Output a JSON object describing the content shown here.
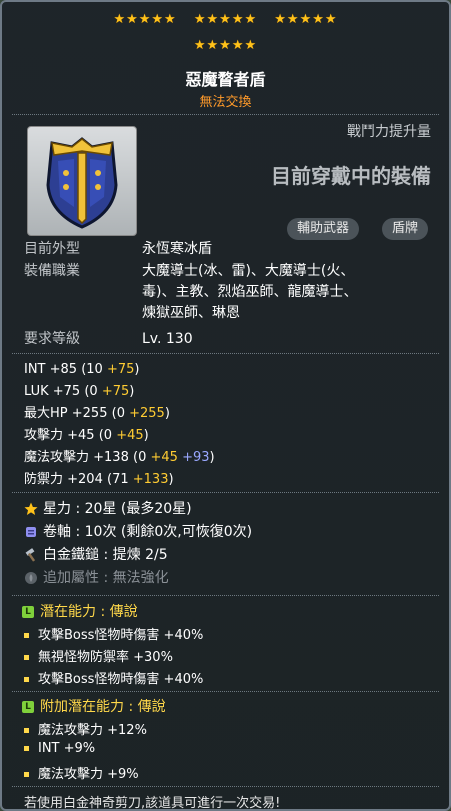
{
  "stars": {
    "row1": [
      "★★★★★",
      "★★★★★",
      "★★★★★"
    ],
    "row2": [
      "★★★★★"
    ]
  },
  "item": {
    "name": "惡魔瞀者盾",
    "tradeability": "無法交換"
  },
  "header": {
    "combat_power_label": "戰鬥力提升量",
    "equipped_text": "目前穿戴中的裝備",
    "badges": [
      "輔助武器",
      "盾牌"
    ]
  },
  "info": {
    "appearance_label": "目前外型",
    "appearance_value": "永恆寒冰盾",
    "jobs_label": "裝備職業",
    "jobs_lines": [
      "大魔導士(冰、雷)、大魔導士(火、",
      "毒)、主教、烈焰巫師、龍魔導士、",
      "煉獄巫師、琳恩"
    ],
    "level_label": "要求等級",
    "level_value": "Lv. 130"
  },
  "stats": [
    {
      "name": "INT",
      "total": "+85",
      "base": "10",
      "bonuses": [
        {
          "v": "+75",
          "c": "yel"
        }
      ]
    },
    {
      "name": "LUK",
      "total": "+75",
      "base": "0",
      "bonuses": [
        {
          "v": "+75",
          "c": "yel"
        }
      ]
    },
    {
      "name": "最大HP",
      "total": "+255",
      "base": "0",
      "bonuses": [
        {
          "v": "+255",
          "c": "yel"
        }
      ]
    },
    {
      "name": "攻擊力",
      "total": "+45",
      "base": "0",
      "bonuses": [
        {
          "v": "+45",
          "c": "yel"
        }
      ]
    },
    {
      "name": "魔法攻擊力",
      "total": "+138",
      "base": "0",
      "bonuses": [
        {
          "v": "+45",
          "c": "yel"
        },
        {
          "v": "+93",
          "c": "blu"
        }
      ]
    },
    {
      "name": "防禦力",
      "total": "+204",
      "base": "71",
      "bonuses": [
        {
          "v": "+133",
          "c": "yel"
        }
      ]
    }
  ],
  "enhance": {
    "starforce_label": "星力",
    "starforce_value": "20星 (最多20星)",
    "scroll_label": "卷軸",
    "scroll_value": "10次 (剩餘0次,可恢復0次)",
    "hammer_label": "白金鐵鎚",
    "hammer_value": "提煉 2/5",
    "additional_label": "追加屬性",
    "additional_value": "無法強化"
  },
  "potential": {
    "head": "潛在能力 : 傳說",
    "lines": [
      "攻擊Boss怪物時傷害 +40%",
      "無視怪物防禦率 +30%",
      "攻擊Boss怪物時傷害 +40%"
    ]
  },
  "bonus_potential": {
    "head": "附加潛在能力 : 傳說",
    "lines": [
      "魔法攻擊力 +12%",
      "INT +9%",
      "魔法攻擊力 +9%"
    ]
  },
  "footer": "若使用白金神奇剪刀,該道具可進行一次交易!",
  "colors": {
    "star": "#ffc21a",
    "orange": "#ff9a2a",
    "bonus_yellow": "#ffcc33",
    "bonus_blue": "#9aa8ff",
    "potential_icon": "#7fd03b"
  },
  "icons": {
    "item": "shield-icon",
    "star": "star-icon",
    "scroll": "scroll-icon",
    "hammer": "hammer-icon",
    "flame": "flame-icon",
    "potential": "potential-icon"
  }
}
